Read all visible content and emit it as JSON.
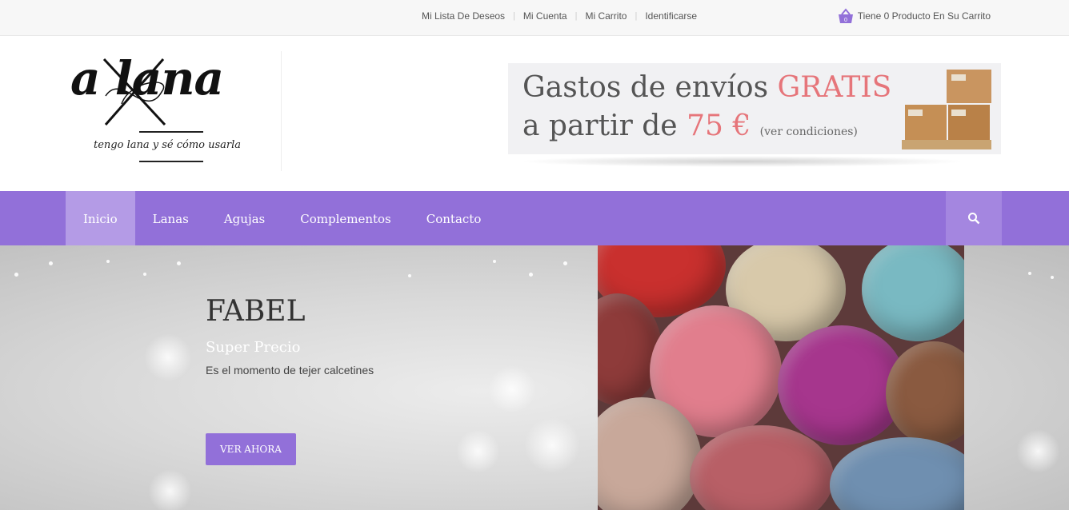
{
  "topbar": {
    "links": [
      "Mi Lista De Deseos",
      "Mi Cuenta",
      "Mi Carrito",
      "Identificarse"
    ],
    "cart_text": "Tiene 0 Producto En Su Carrito",
    "cart_icon": "shopping-basket-icon"
  },
  "logo": {
    "word": "a lana",
    "tagline": "tengo lana y sé cómo usarla"
  },
  "promo": {
    "line1_text": "Gastos de envíos ",
    "line1_accent": "GRATIS",
    "line2_text": "a partir de ",
    "line2_accent": "75 €",
    "line2_small": "(ver condiciones)"
  },
  "nav": {
    "items": [
      "Inicio",
      "Lanas",
      "Agujas",
      "Complementos",
      "Contacto"
    ],
    "active": "Inicio",
    "search_icon": "search-icon"
  },
  "slider": {
    "title": "FABEL",
    "subtitle": "Super Precio",
    "text": "Es el momento de tejer calcetines",
    "button": "VER AHORA"
  },
  "colors": {
    "brand_purple": "#9270d9",
    "nav_active": "#b49be6",
    "accent_pink": "#e6757a"
  }
}
